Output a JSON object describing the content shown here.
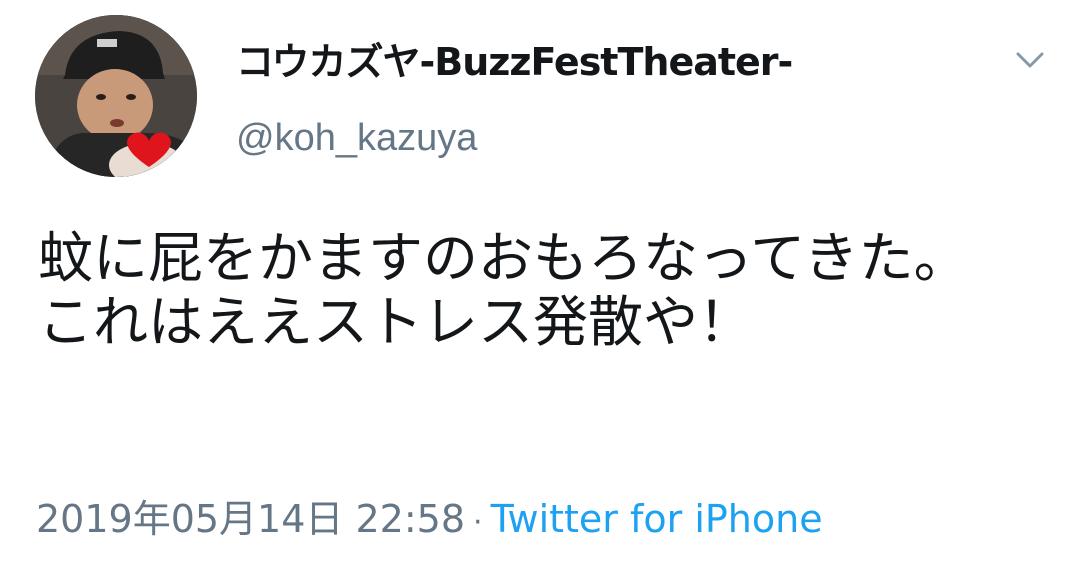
{
  "tweet": {
    "author": {
      "display_name": "コウカズヤ-BuzzFestTheater-",
      "handle": "@koh_kazuya",
      "avatar": "profile-photo"
    },
    "text": "蚊に屁をかますのおもろなってきた。\nこれはええストレス発散や！",
    "date": "2019年05月14日 22:58",
    "separator": "·",
    "source": "Twitter for iPhone",
    "menu_icon": "chevron-down-icon"
  },
  "colors": {
    "text_primary": "#14171a",
    "text_secondary": "#657786",
    "link": "#1da1f2"
  }
}
